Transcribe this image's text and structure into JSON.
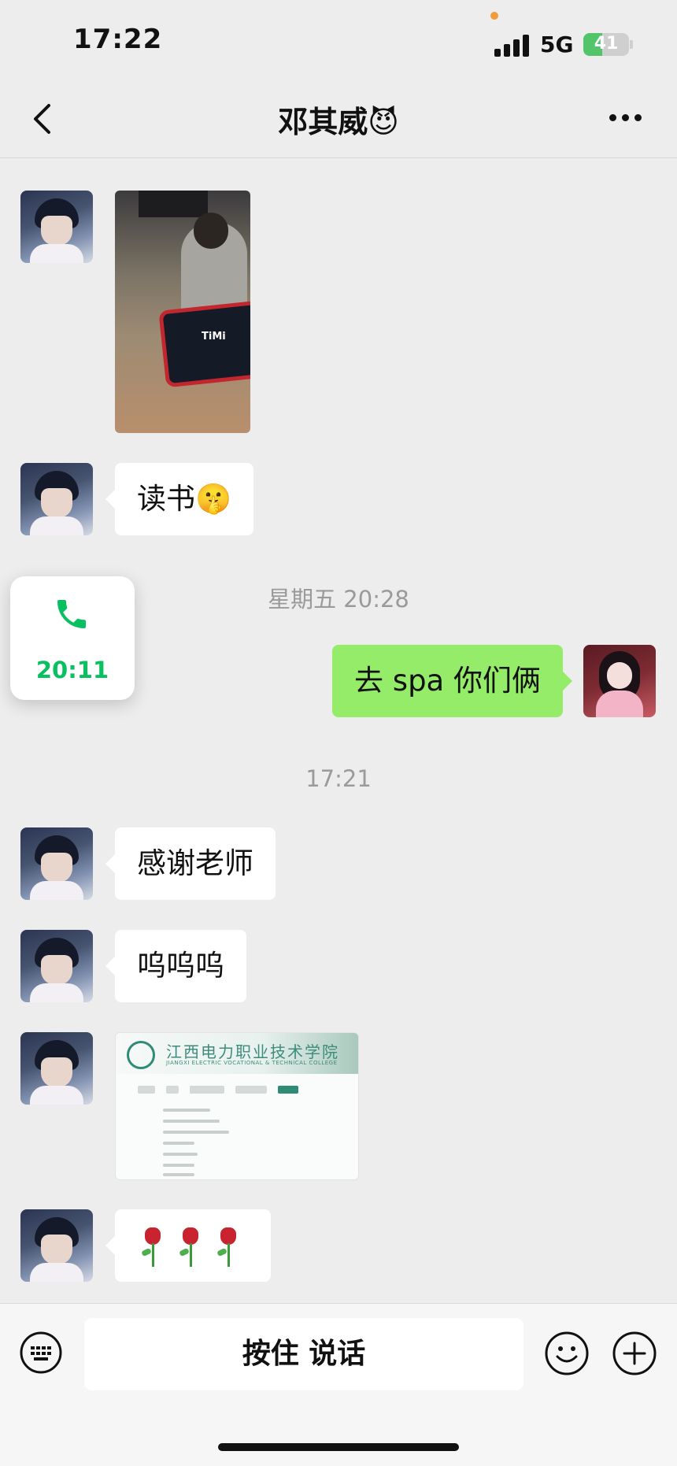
{
  "status_bar": {
    "time": "17:22",
    "network": "5G",
    "battery": "41",
    "battery_level_percent": 41
  },
  "nav": {
    "title": "邓其威😈",
    "back_icon": "chevron-left-icon",
    "more_icon": "more-dots-icon"
  },
  "messages": {
    "read_text": "读书🤫",
    "timestamp_1": "星期五 20:28",
    "sent_text": "去 spa 你们俩",
    "timestamp_2": "17:21",
    "thanks_text": "感谢老师",
    "cry_text": "呜呜呜",
    "doc_cn_title": "江西电力职业技术学院",
    "doc_en_title": "JIANGXI ELECTRIC VOCATIONAL & TECHNICAL COLLEGE",
    "photo_logo_text": "TiMi",
    "roses_icon": "rose-icon"
  },
  "call_card": {
    "time": "20:11",
    "icon": "phone-icon",
    "accent": "#07c160"
  },
  "input_bar": {
    "talk_label": "按住 说话",
    "keyboard_icon": "keyboard-icon",
    "emoji_icon": "emoji-icon",
    "plus_icon": "plus-icon"
  },
  "colors": {
    "background": "#ededed",
    "sent_bubble": "#95ec69",
    "received_bubble": "#ffffff"
  }
}
